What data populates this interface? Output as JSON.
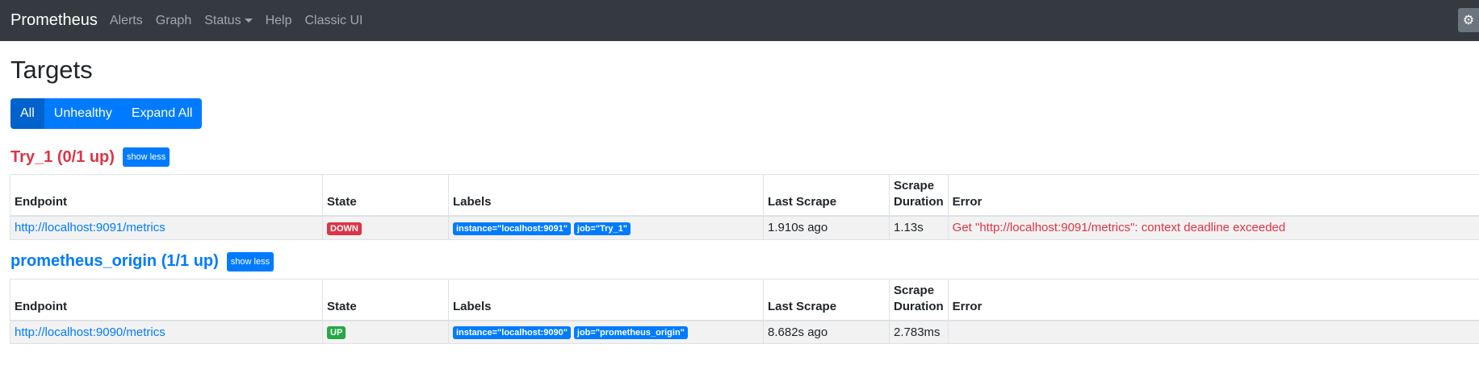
{
  "navbar": {
    "brand": "Prometheus",
    "links": [
      "Alerts",
      "Graph",
      "Status",
      "Help",
      "Classic UI"
    ],
    "theme_icon": "gear-icon"
  },
  "page": {
    "title": "Targets",
    "filters": [
      "All",
      "Unhealthy",
      "Expand All"
    ],
    "active_filter": "All"
  },
  "columns": [
    "Endpoint",
    "State",
    "Labels",
    "Last Scrape",
    "Scrape",
    "Duration",
    "Error"
  ],
  "pools": [
    {
      "title": "Try_1 (0/1 up)",
      "toggle_label": "show less",
      "healthy": false,
      "targets": [
        {
          "endpoint": "http://localhost:9091/metrics",
          "state": "DOWN",
          "labels": [
            "instance=\"localhost:9091\"",
            "job=\"Try_1\""
          ],
          "last_scrape": "1.910s ago",
          "duration": "1.13s",
          "error": "Get \"http://localhost:9091/metrics\": context deadline exceeded"
        }
      ]
    },
    {
      "title": "prometheus_origin (1/1 up)",
      "toggle_label": "show less",
      "healthy": true,
      "targets": [
        {
          "endpoint": "http://localhost:9090/metrics",
          "state": "UP",
          "labels": [
            "instance=\"localhost:9090\"",
            "job=\"prometheus_origin\""
          ],
          "last_scrape": "8.682s ago",
          "duration": "2.783ms",
          "error": ""
        }
      ]
    }
  ],
  "colors": {
    "navbar_bg": "#343a40",
    "primary": "#007bff",
    "danger": "#dc3545",
    "success": "#28a745"
  }
}
